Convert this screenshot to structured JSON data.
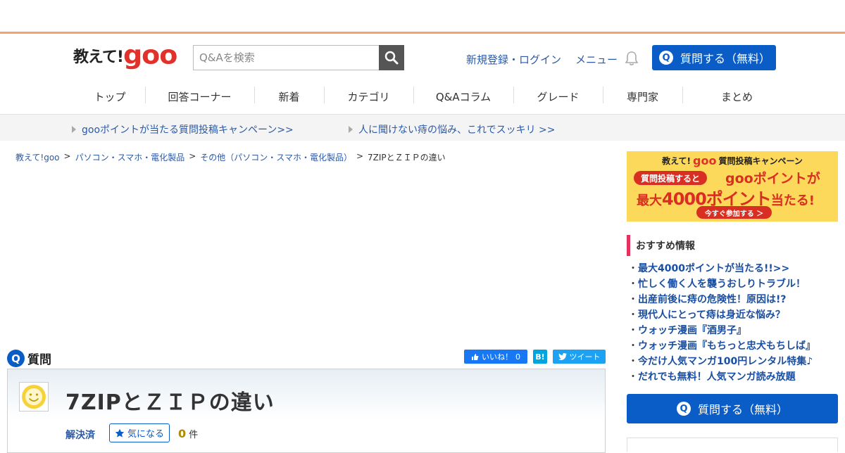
{
  "header": {
    "logo_text": "教えて!",
    "logo_brand": "goo",
    "search_placeholder": "Q&Aを検索",
    "links": [
      "新規登録・ログイン",
      "メニュー"
    ],
    "ask_button": "質問する（無料）"
  },
  "nav": {
    "items": [
      "トップ",
      "回答コーナー",
      "新着",
      "カテゴリ",
      "Q&Aコラム",
      "グレード",
      "専門家",
      "まとめ"
    ]
  },
  "promo": {
    "links": [
      "gooポイントが当たる質問投稿キャンペーン>>",
      "人に聞けない痔の悩み、これでスッキリ >>"
    ]
  },
  "breadcrumb": {
    "items": [
      "教えて!goo",
      "パソコン・スマホ・電化製品",
      "その他（パソコン・スマホ・電化製品）"
    ],
    "current": "7ZIPとＺＩＰの違い",
    "separator": ">"
  },
  "question": {
    "heading": "質問",
    "q_icon": "Q",
    "title": "7ZIPとＺＩＰの違い",
    "status": "解決済",
    "kininaru": "気になる",
    "count": "0",
    "count_unit": "件"
  },
  "social": {
    "like": "いいね！",
    "like_count": "0",
    "hatena": "B!",
    "tweet": "ツイート"
  },
  "sidebar": {
    "banner": {
      "line1_pre": "教えて!",
      "line1_brand": "goo",
      "line1_post": "質問投稿キャンペーン",
      "pill": "質問投稿すると",
      "brand2": "goo",
      "points": "ポイントが",
      "big_pre": "最大",
      "big_num": "4000ポイント",
      "big_post": "当たる!",
      "cta": "今すぐ参加する ＞"
    },
    "recommend_title": "おすすめ情報",
    "recommend_items": [
      "最大4000ポイントが当たる!!>>",
      "忙しく働く人を襲うおしりトラブル！",
      "出産前後に痔の危険性！原因は!?",
      "現代人にとって痔は身近な悩み？",
      "ウォッチ漫画『酒男子』",
      "ウォッチ漫画『もちっと忠犬もちしば』",
      "今だけ人気マンガ100円レンタル特集♪",
      "だれでも無料！人気マンガ読み放題"
    ],
    "ask_button": "質問する（無料）"
  },
  "colors": {
    "accent_blue": "#0a5cc7",
    "brand_red": "#e0312b",
    "top_border": "#f5a26a",
    "recommend_bar": "#e3325d"
  }
}
